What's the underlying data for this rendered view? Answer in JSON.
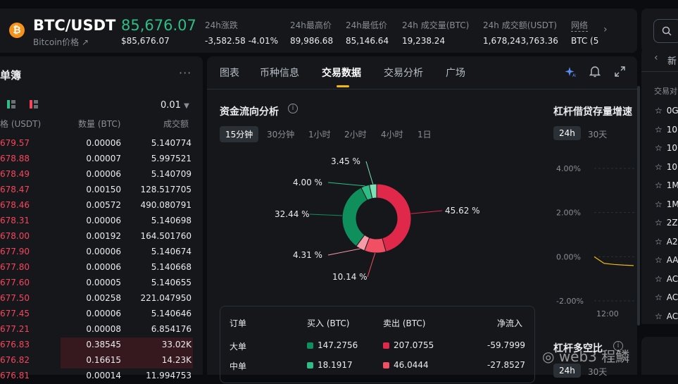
{
  "header": {
    "symbol": "BTC/USDT",
    "subtitle": "Bitcoin价格",
    "last_price": "85,676.07",
    "last_price_usd": "$85,676.07",
    "stats": [
      {
        "label": "24h涨跌",
        "value": "-3,582.58 -4.01%"
      },
      {
        "label": "24h最高价",
        "value": "89,986.68"
      },
      {
        "label": "24h最低价",
        "value": "85,146.64"
      },
      {
        "label": "24h 成交量(BTC)",
        "value": "19,238.24"
      },
      {
        "label": "24h 成交额(USDT)",
        "value": "1,678,243,763.36"
      },
      {
        "label": "网络",
        "value": "BTC (5"
      }
    ]
  },
  "orderbook": {
    "title": "单簿",
    "precision": "0.01",
    "col_price": "格 (USDT)",
    "col_amount": "数量 (BTC)",
    "col_total": "成交额",
    "rows": [
      {
        "price": "679.57",
        "amount": "0.00006",
        "total": "5.140774"
      },
      {
        "price": "678.88",
        "amount": "0.00007",
        "total": "5.997521"
      },
      {
        "price": "678.49",
        "amount": "0.00006",
        "total": "5.140709"
      },
      {
        "price": "678.47",
        "amount": "0.00150",
        "total": "128.517705"
      },
      {
        "price": "678.46",
        "amount": "0.00572",
        "total": "490.080791"
      },
      {
        "price": "678.31",
        "amount": "0.00006",
        "total": "5.140698"
      },
      {
        "price": "678.00",
        "amount": "0.00192",
        "total": "164.501760"
      },
      {
        "price": "677.90",
        "amount": "0.00006",
        "total": "5.140674"
      },
      {
        "price": "677.80",
        "amount": "0.00006",
        "total": "5.140668"
      },
      {
        "price": "677.60",
        "amount": "0.00005",
        "total": "5.140655"
      },
      {
        "price": "677.50",
        "amount": "0.00258",
        "total": "221.047950"
      },
      {
        "price": "677.45",
        "amount": "0.00006",
        "total": "5.140646"
      },
      {
        "price": "677.21",
        "amount": "0.00008",
        "total": "6.854176"
      },
      {
        "price": "676.83",
        "amount": "0.38545",
        "total": "33.02K"
      },
      {
        "price": "676.82",
        "amount": "0.16615",
        "total": "14.23K"
      },
      {
        "price": "676.81",
        "amount": "0.00014",
        "total": "11.994753"
      }
    ]
  },
  "tabs": [
    "图表",
    "币种信息",
    "交易数据",
    "交易分析",
    "广场"
  ],
  "active_tab": "交易数据",
  "fund_flow": {
    "title": "资金流向分析",
    "intervals": [
      "15分钟",
      "30分钟",
      "1小时",
      "2小时",
      "4小时",
      "1日"
    ],
    "active_interval": "15分钟",
    "chart_data": {
      "type": "pie",
      "categories": [
        "sell-large",
        "sell-medium",
        "sell-small",
        "buy-large",
        "buy-medium",
        "buy-small"
      ],
      "values": [
        45.62,
        10.14,
        4.31,
        32.44,
        4.0,
        3.45
      ],
      "labels": [
        "45.62 %",
        "10.14 %",
        "4.31 %",
        "32.44 %",
        "4.00 %",
        "3.45 %"
      ],
      "colors": [
        "#e0294a",
        "#f04f64",
        "#f59aa6",
        "#0e8f5c",
        "#2ebd85",
        "#7ee0b4"
      ]
    },
    "table": {
      "headers": [
        "订单",
        "买入 (BTC)",
        "卖出 (BTC)",
        "净流入"
      ],
      "rows": [
        {
          "name": "大单",
          "buy": "147.2756",
          "sell": "207.0755",
          "net": "-59.7999"
        },
        {
          "name": "中单",
          "buy": "18.1917",
          "sell": "46.0444",
          "net": "-27.8527"
        }
      ]
    }
  },
  "margin": {
    "title": "杠杆借贷存量增速",
    "periods": [
      "24h",
      "30天"
    ],
    "active_period": "24h",
    "chart_data": {
      "type": "line",
      "yticks": [
        "4.00%",
        "2.00%",
        "0.00%",
        "-2.00%"
      ],
      "xticks": [
        "12:00"
      ],
      "ylim": [
        -2,
        4
      ],
      "series": [
        {
          "values": [
            0.0,
            -0.3,
            -0.35,
            -0.38,
            -0.4
          ]
        }
      ],
      "color": "#f0b90b"
    },
    "ratio_title": "杠杆多空比",
    "ratio_periods": [
      "24h",
      "30天"
    ]
  },
  "right_panel": {
    "tab": "新",
    "section": "交易对",
    "items": [
      "0G",
      "10",
      "10",
      "10",
      "1M",
      "1M",
      "2Z",
      "A2",
      "AA",
      "AC",
      "AC",
      "AC"
    ]
  },
  "watermark": "web3 程鱗"
}
